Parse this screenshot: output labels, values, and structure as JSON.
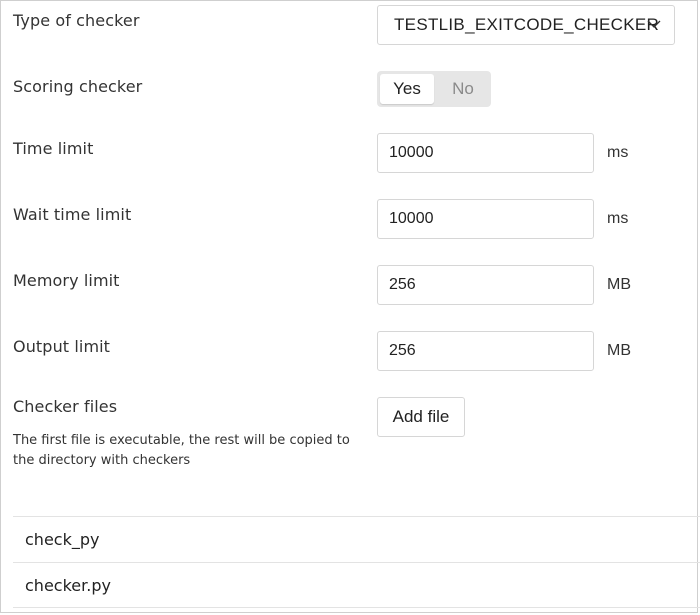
{
  "checker": {
    "type_label": "Type of checker",
    "type_value": "TESTLIB_EXITCODE_CHECKER"
  },
  "scoring": {
    "label": "Scoring checker",
    "yes": "Yes",
    "no": "No",
    "selected": "Yes"
  },
  "limits": {
    "time": {
      "label": "Time limit",
      "value": "10000",
      "unit": "ms"
    },
    "wait_time": {
      "label": "Wait time limit",
      "value": "10000",
      "unit": "ms"
    },
    "memory": {
      "label": "Memory limit",
      "value": "256",
      "unit": "MB"
    },
    "output": {
      "label": "Output limit",
      "value": "256",
      "unit": "MB"
    }
  },
  "files": {
    "label": "Checker files",
    "hint": "The first file is executable, the rest will be copied to the directory with checkers",
    "add_button": "Add file",
    "items": [
      {
        "name": "check_py"
      },
      {
        "name": "checker.py"
      }
    ]
  },
  "icons": {
    "select_arrow": "chevron-down-icon"
  }
}
